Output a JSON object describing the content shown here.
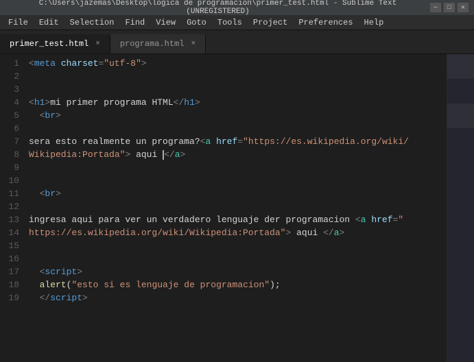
{
  "titlebar": {
    "text": "C:\\Users\\jazemas\\Desktop\\logica de programacion\\primer_test.html - Sublime Text (UNREGISTERED)",
    "minimize": "─",
    "maximize": "□",
    "close": "✕"
  },
  "menubar": {
    "items": [
      "File",
      "Edit",
      "Selection",
      "Find",
      "View",
      "Goto",
      "Tools",
      "Project",
      "Preferences",
      "Help"
    ]
  },
  "tabs": [
    {
      "label": "primer_test.html",
      "active": true
    },
    {
      "label": "programa.html",
      "active": false
    }
  ],
  "linenumbers": [
    1,
    2,
    3,
    4,
    5,
    6,
    7,
    8,
    9,
    10,
    11,
    12,
    13,
    14,
    15,
    16,
    17,
    18,
    19
  ],
  "code": {
    "lines": [
      {
        "html": "<span class='tag'>&lt;</span><span class='tag-name'>meta</span> <span class='attr-name'>charset</span><span class='tag'>=</span><span class='attr-value'>\"utf-8\"</span><span class='tag'>&gt;</span>"
      },
      {
        "html": ""
      },
      {
        "html": ""
      },
      {
        "html": "<span class='tag'>&lt;</span><span class='tag-name'>h1</span><span class='tag'>&gt;</span><span class='text-content'>mi primer programa HTML</span><span class='tag'>&lt;/</span><span class='tag-name'>h1</span><span class='tag'>&gt;</span>"
      },
      {
        "html": "  <span class='tag'>&lt;</span><span class='tag-name'>br</span><span class='tag'>&gt;</span>"
      },
      {
        "html": ""
      },
      {
        "html": "<span class='text-content'>sera esto realmente un programa?</span><span class='tag'>&lt;</span><span class='link-tag'>a</span> <span class='attr-name'>href</span><span class='tag'>=</span><span class='attr-value'>\"https://es.wikipedia.org/wiki/</span>"
      },
      {
        "html": "<span class='attr-value'>Wikipedia:Portada\"</span><span class='tag'>&gt;</span> <span class='text-content'>aqui </span><span class='cursor-inline'></span><span class='tag'>&lt;/</span><span class='link-tag'>a</span><span class='tag'>&gt;</span>"
      },
      {
        "html": ""
      },
      {
        "html": ""
      },
      {
        "html": "  <span class='tag'>&lt;</span><span class='tag-name'>br</span><span class='tag'>&gt;</span>"
      },
      {
        "html": ""
      },
      {
        "html": "<span class='text-content'>ingresa aqui para ver un verdadero lenguaje der programacion </span><span class='tag'>&lt;</span><span class='link-tag'>a</span> <span class='attr-name'>href</span><span class='tag'>=</span><span class='attr-value'>\"</span>"
      },
      {
        "html": "<span class='attr-value'>https://es.wikipedia.org/wiki/Wikipedia:Portada\"</span><span class='tag'>&gt;</span> <span class='text-content'>aqui </span><span class='tag'>&lt;/</span><span class='link-tag'>a</span><span class='tag'>&gt;</span>"
      },
      {
        "html": ""
      },
      {
        "html": ""
      },
      {
        "html": "  <span class='tag'>&lt;</span><span class='tag-name'>script</span><span class='tag'>&gt;</span>"
      },
      {
        "html": "  <span class='function-call'>alert</span><span class='white-text'>(</span><span class='string'>\"esto si es lenguaje de programacion\"</span><span class='white-text'>);</span>"
      },
      {
        "html": "  <span class='tag'>&lt;/</span><span class='tag-name'>script</span><span class='tag'>&gt;</span>"
      }
    ]
  }
}
